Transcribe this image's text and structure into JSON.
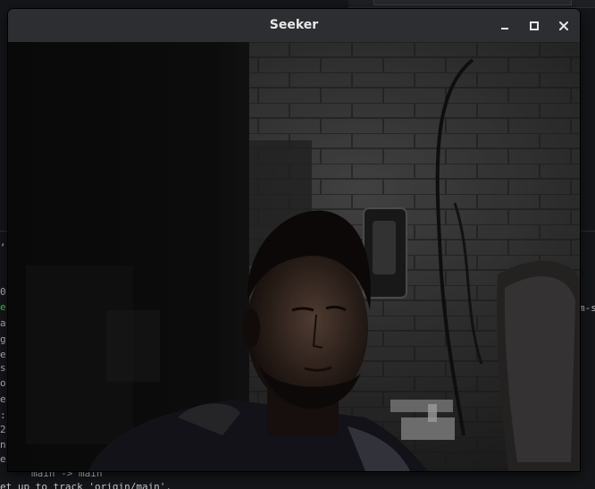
{
  "window": {
    "title": "Seeker",
    "controls": {
      "minimize": "minimize",
      "maximize": "maximize",
      "close": "close"
    }
  },
  "camera_feed": {
    "description_icon": "webcam-frame"
  },
  "background_terminal": {
    "left_fragments": [
      ",",
      "0",
      "e",
      "a",
      "g",
      "e",
      "s",
      "o",
      "e",
      ":",
      "2",
      "n",
      "e"
    ],
    "right_fragment": "m-s",
    "bottom_lines": [
      "main -> main",
      "et up to track 'origin/main'."
    ]
  },
  "colors": {
    "titlebar": "#2c2e31",
    "terminal_bg": "#141619",
    "terminal_green": "#4ec94e"
  }
}
